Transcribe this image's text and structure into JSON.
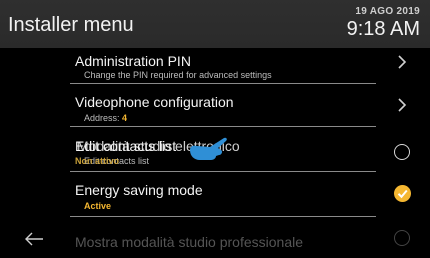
{
  "header": {
    "title": "Installer menu",
    "date": "19 AGO 2019",
    "time": "9:18 AM"
  },
  "menu": {
    "items": [
      {
        "title": "Administration PIN",
        "subtitle": "Change the PIN required for advanced settings",
        "control": "chevron"
      },
      {
        "title": "Videophone configuration",
        "subtitle_label": "Address:",
        "subtitle_value": "4",
        "control": "chevron"
      },
      {
        "title": "Edit contacts list",
        "title_overlay": "Modalità studio elettronico",
        "subtitle": "Edit contacts list",
        "subtitle_overlay": "Non attivo",
        "control": "radio"
      },
      {
        "title": "Energy saving mode",
        "status": "Active",
        "control": "checkmark"
      },
      {
        "title": "Mostra modalità studio professionale",
        "control": "radio"
      }
    ]
  },
  "colors": {
    "accent": "#f5b731",
    "header_bg": "#2f2f2f",
    "background": "#000000"
  },
  "icons": {
    "back": "arrow-left-icon",
    "chevron": "chevron-right-icon",
    "radio": "radio-unchecked-icon",
    "checkmark": "checkmark-circle-icon",
    "pointer": "hand-pointer-icon"
  }
}
